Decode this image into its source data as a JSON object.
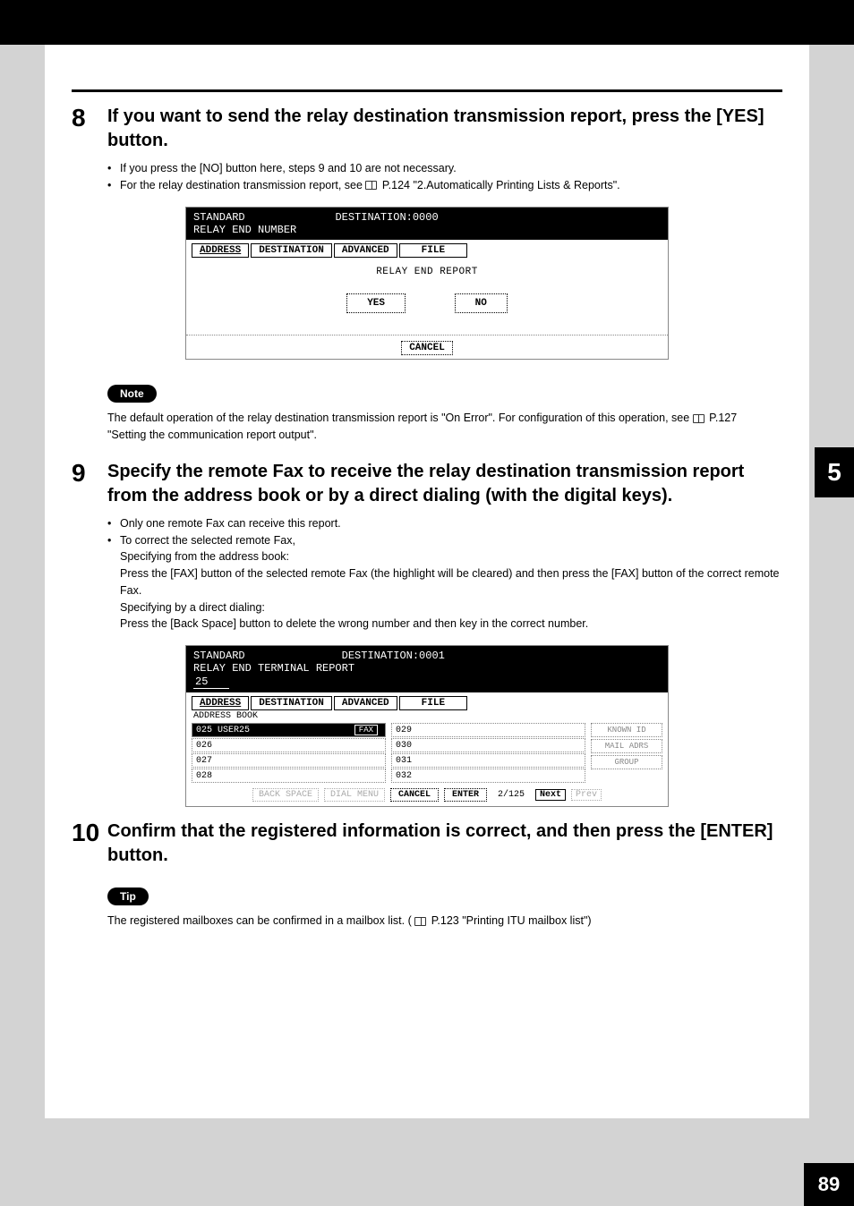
{
  "chapter_tab": "5",
  "page_number": "89",
  "step8": {
    "num": "8",
    "title": "If you want to send the relay destination transmission report, press the [YES] button.",
    "bullets": [
      "If you press the [NO] button here, steps 9 and 10 are not necessary.",
      "For the relay destination transmission report, see "
    ],
    "ref": "P.124 \"2.Automatically Printing Lists & Reports\"."
  },
  "screen1": {
    "header_left": "STANDARD",
    "header_right": "DESTINATION:0000",
    "subtitle": "RELAY END NUMBER",
    "tabs": [
      "ADDRESS",
      "DESTINATION",
      "ADVANCED",
      "FILE"
    ],
    "body_label": "RELAY END REPORT",
    "yes": "YES",
    "no": "NO",
    "cancel": "CANCEL"
  },
  "note": {
    "label": "Note",
    "text_part1": "The default operation of the relay destination transmission report is \"On Error\". For configuration of this operation, see ",
    "ref": "P.127 \"Setting the communication report output\"."
  },
  "step9": {
    "num": "9",
    "title": "Specify the remote Fax to receive the relay destination transmission report from the address book or by a direct dialing (with the digital keys).",
    "b1": "Only one remote Fax can receive this report.",
    "b2": "To correct the selected remote Fax,",
    "l1": "Specifying from the address book:",
    "l2": "Press the [FAX] button of the selected remote Fax (the highlight will be cleared) and then press the [FAX] button of the correct remote Fax.",
    "l3": "Specifying by a direct dialing:",
    "l4": "Press the [Back Space] button to delete the wrong number and then key in the correct number."
  },
  "screen2": {
    "header_left": "STANDARD",
    "header_right": "DESTINATION:0001",
    "subtitle": "RELAY END TERMINAL REPORT",
    "entry_value": "25",
    "tabs": [
      "ADDRESS",
      "DESTINATION",
      "ADVANCED",
      "FILE"
    ],
    "ab_label": "ADDRESS BOOK",
    "col1": [
      {
        "id": "025",
        "name": "USER25",
        "fax": "FAX",
        "selected": true
      },
      {
        "id": "026",
        "name": "",
        "selected": false
      },
      {
        "id": "027",
        "name": "",
        "selected": false
      },
      {
        "id": "028",
        "name": "",
        "selected": false
      }
    ],
    "col2": [
      {
        "id": "029"
      },
      {
        "id": "030"
      },
      {
        "id": "031"
      },
      {
        "id": "032"
      }
    ],
    "side_buttons": [
      "KNOWN ID",
      "MAIL ADRS",
      "GROUP"
    ],
    "footer": {
      "backspace": "BACK SPACE",
      "dialmenu": "DIAL MENU",
      "cancel": "CANCEL",
      "enter": "ENTER",
      "page": "2/125",
      "next": "Next",
      "prev": "Prev"
    }
  },
  "step10": {
    "num": "10",
    "title": "Confirm that the registered information is correct, and then press the [ENTER] button."
  },
  "tip": {
    "label": "Tip",
    "text_part1": "The registered mailboxes can be confirmed in a mailbox list. (",
    "ref": "P.123 \"Printing ITU mailbox list\")"
  }
}
